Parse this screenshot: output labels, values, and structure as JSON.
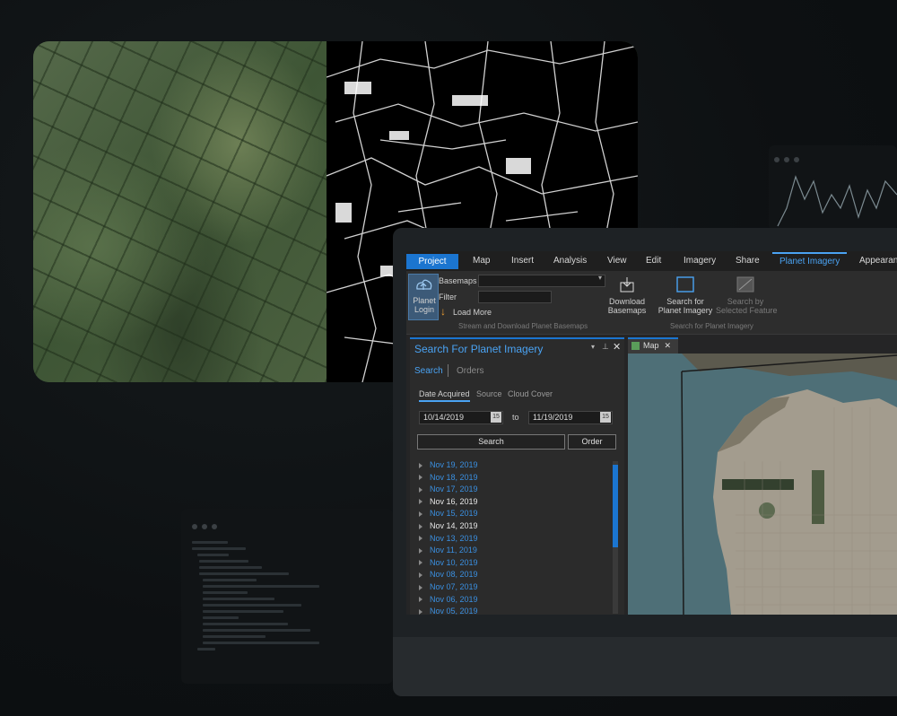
{
  "ribbon": {
    "tabs": {
      "project": "Project",
      "map": "Map",
      "insert": "Insert",
      "analysis": "Analysis",
      "view": "View",
      "edit": "Edit",
      "imagery": "Imagery",
      "share": "Share",
      "planet_imagery": "Planet Imagery",
      "appearance": "Appearan"
    },
    "planet_login": "Planet\nLogin",
    "basemaps_label": "Basemaps",
    "filter_label": "Filter",
    "load_more": "Load More",
    "group1_caption": "Stream and Download Planet Basemaps",
    "download_basemaps": "Download\nBasemaps",
    "search_planet": "Search for\nPlanet Imagery",
    "search_selected": "Search by\nSelected Feature",
    "group2_caption": "Search for Planet Imagery"
  },
  "panel": {
    "title": "Search For Planet Imagery",
    "tab_search": "Search",
    "tab_orders": "Orders",
    "sub_date": "Date Acquired",
    "sub_source": "Source",
    "sub_cloud": "Cloud Cover",
    "date_from": "10/14/2019",
    "date_to": "11/19/2019",
    "to_label": "to",
    "cal": "15",
    "search_btn": "Search",
    "order_btn": "Order",
    "dates": [
      "Nov 19, 2019",
      "Nov 18, 2019",
      "Nov 17, 2019",
      "Nov 16, 2019",
      "Nov 15, 2019",
      "Nov 14, 2019",
      "Nov 13, 2019",
      "Nov 11, 2019",
      "Nov 10, 2019",
      "Nov 08, 2019",
      "Nov 07, 2019",
      "Nov 06, 2019",
      "Nov 05, 2019"
    ]
  },
  "map": {
    "tab_label": "Map"
  },
  "colors": {
    "accent": "#4aa3f3",
    "project": "#1b75d0",
    "link_blue": "#3a8fe0",
    "white_text": "#e6e6e6"
  }
}
